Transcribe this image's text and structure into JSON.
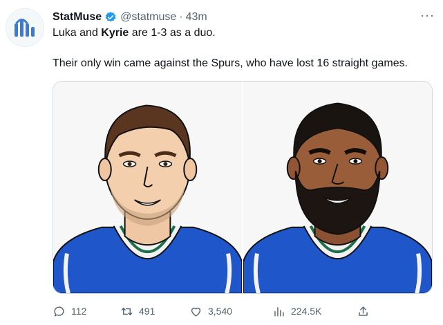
{
  "tweet": {
    "author_name": "StatMuse",
    "handle": "@statmuse",
    "separator": "·",
    "time": "43m",
    "more_label": "···",
    "text_line1_prefix": "Luka and ",
    "text_line1_bold": "Kyrie",
    "text_line1_suffix": " are 1-3 as a duo.",
    "text_line2": "Their only win came against the Spurs, who have lost 16 straight games."
  },
  "actions": {
    "replies": "112",
    "retweets": "491",
    "likes": "3,540",
    "views": "224.5K"
  },
  "colors": {
    "brand_blue": "#1d9bf0",
    "jersey_blue": "#1f56c9",
    "jersey_trim": "#1e6e4a"
  },
  "icons": [
    "statmuse-logo-icon",
    "verified-badge-icon",
    "more-icon",
    "reply-icon",
    "retweet-icon",
    "like-icon",
    "views-icon",
    "share-icon"
  ]
}
